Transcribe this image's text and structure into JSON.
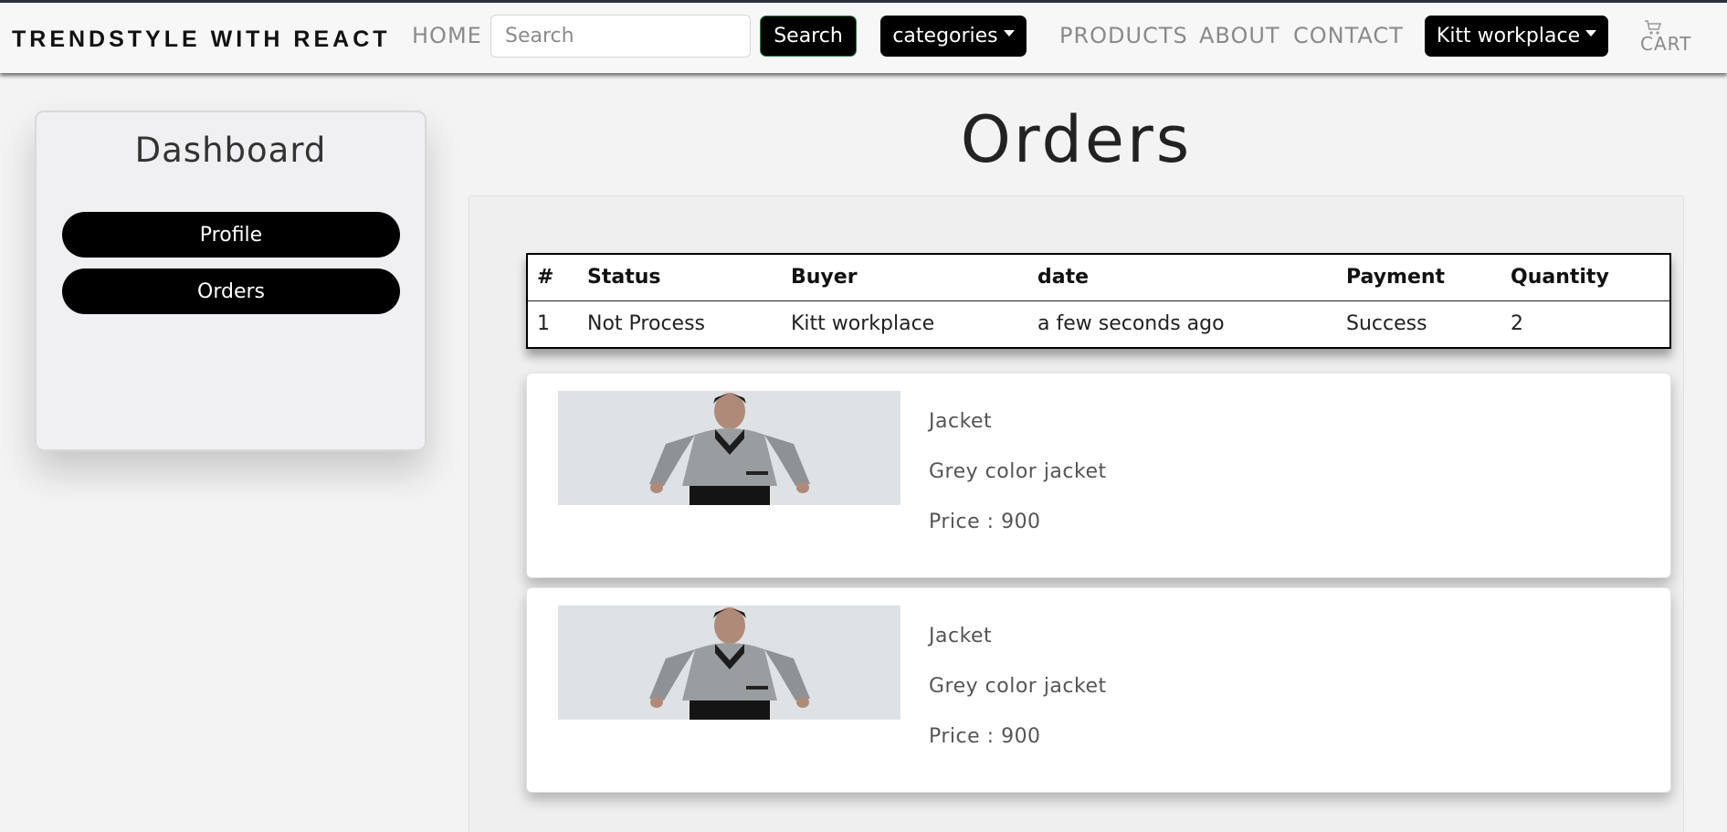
{
  "navbar": {
    "brand": "TRENDSTYLE WITH REACT",
    "home": "HOME",
    "search_placeholder": "Search",
    "search_button": "Search",
    "categories": "categories",
    "products": "PRODUCTS",
    "about": "ABOUT",
    "contact": "CONTACT",
    "account": "Kitt workplace",
    "cart": "CART",
    "cart_icon": "cart-icon"
  },
  "sidebar": {
    "title": "Dashboard",
    "items": [
      {
        "label": "Profile"
      },
      {
        "label": "Orders"
      }
    ]
  },
  "main": {
    "title": "Orders",
    "table": {
      "headers": [
        "#",
        "Status",
        "Buyer",
        "date",
        "Payment",
        "Quantity"
      ],
      "rows": [
        [
          "1",
          "Not Process",
          "Kitt workplace",
          "a few seconds ago",
          "Success",
          "2"
        ]
      ]
    },
    "products": [
      {
        "name": "Jacket",
        "description": "Grey color jacket",
        "price": "Price : 900"
      },
      {
        "name": "Jacket",
        "description": "Grey color jacket",
        "price": "Price : 900"
      }
    ]
  },
  "colors": {
    "accent": "#000000",
    "background": "#f3f3f4",
    "nav_text": "#8a8a8a"
  }
}
